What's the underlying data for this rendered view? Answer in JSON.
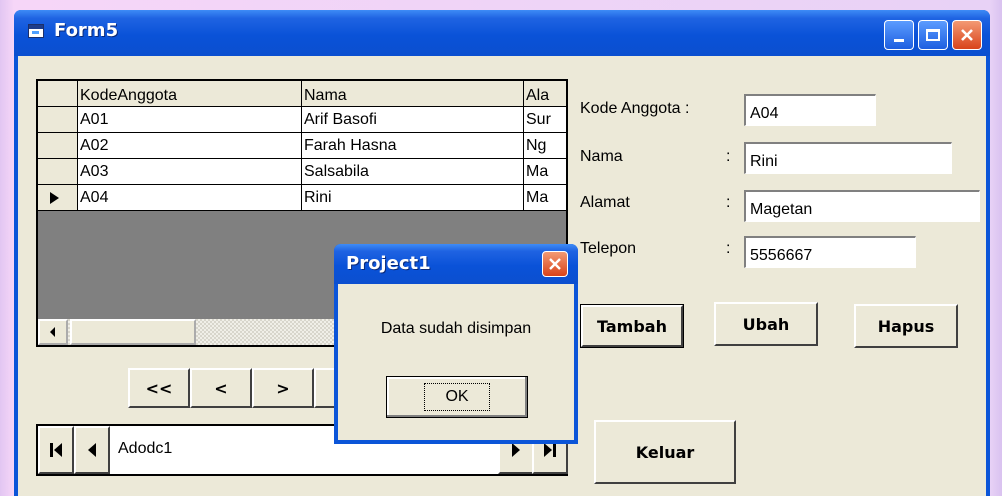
{
  "window": {
    "title": "Form5",
    "title_icon": "form-icon"
  },
  "title_buttons": {
    "minimize": "minimize-icon",
    "maximize": "maximize-icon",
    "close": "close-icon"
  },
  "grid": {
    "headers": [
      "KodeAnggota",
      "Nama",
      "Ala"
    ],
    "rows": [
      [
        "A01",
        "Arif Basofi",
        "Sur"
      ],
      [
        "A02",
        "Farah Hasna",
        "Ng"
      ],
      [
        "A03",
        "Salsabila",
        "Ma"
      ],
      [
        "A04",
        "Rini",
        "Ma"
      ]
    ],
    "current_row_indicator": "row-pointer-icon"
  },
  "form": {
    "kode_label": "Kode Anggota :",
    "kode_value": "A04",
    "nama_label": "Nama",
    "nama_value": "Rini",
    "alamat_label": "Alamat",
    "alamat_value": "Magetan",
    "telepon_label": "Telepon",
    "telepon_value": "5556667",
    "colon": ":"
  },
  "buttons": {
    "tambah": "Tambah",
    "ubah": "Ubah",
    "hapus": "Hapus",
    "keluar": "Keluar"
  },
  "nav_buttons": {
    "first": "<<",
    "prev": "<",
    "next": ">"
  },
  "adodc": {
    "caption": "Adodc1"
  },
  "dialog": {
    "title": "Project1",
    "message": "Data sudah disimpan",
    "ok": "OK"
  },
  "colors": {
    "titlebar": "#0b55d8",
    "client": "#ece9d8",
    "close_button": "#d9431a"
  }
}
